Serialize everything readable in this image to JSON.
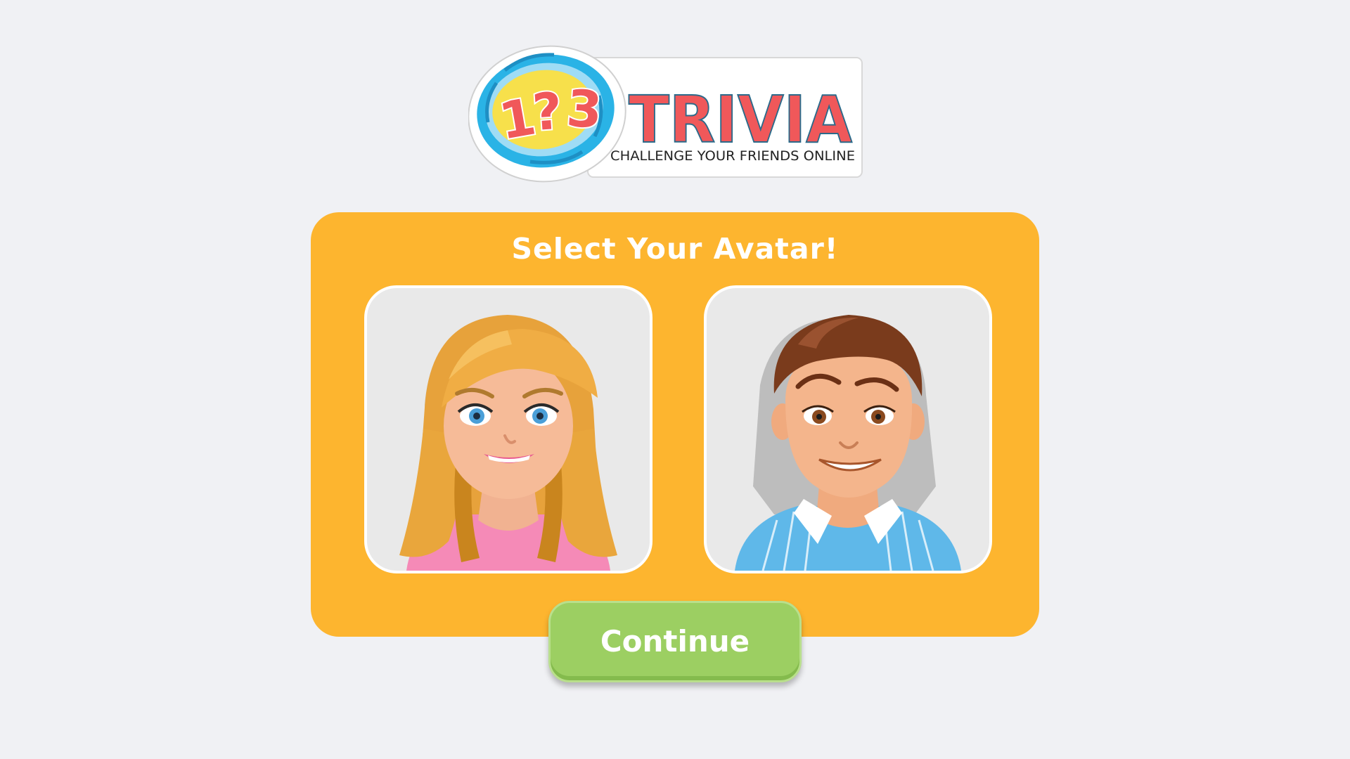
{
  "logo": {
    "digits": [
      "1",
      "?",
      "3"
    ],
    "wordmark": "TRIVIA",
    "tagline": "CHALLENGE YOUR FRIENDS ONLINE"
  },
  "panel": {
    "title": "Select Your Avatar!",
    "avatars": [
      {
        "id": "female",
        "icon": "girl-avatar-icon"
      },
      {
        "id": "male",
        "icon": "boy-avatar-icon"
      }
    ]
  },
  "actions": {
    "continue_label": "Continue"
  },
  "colors": {
    "background": "#f0f1f4",
    "panel": "#fdb52f",
    "continue_button": "#9ccf62",
    "wordmark": "#f0585a",
    "logo_blue": "#2ab3e6",
    "logo_yellow": "#f7e04b"
  }
}
